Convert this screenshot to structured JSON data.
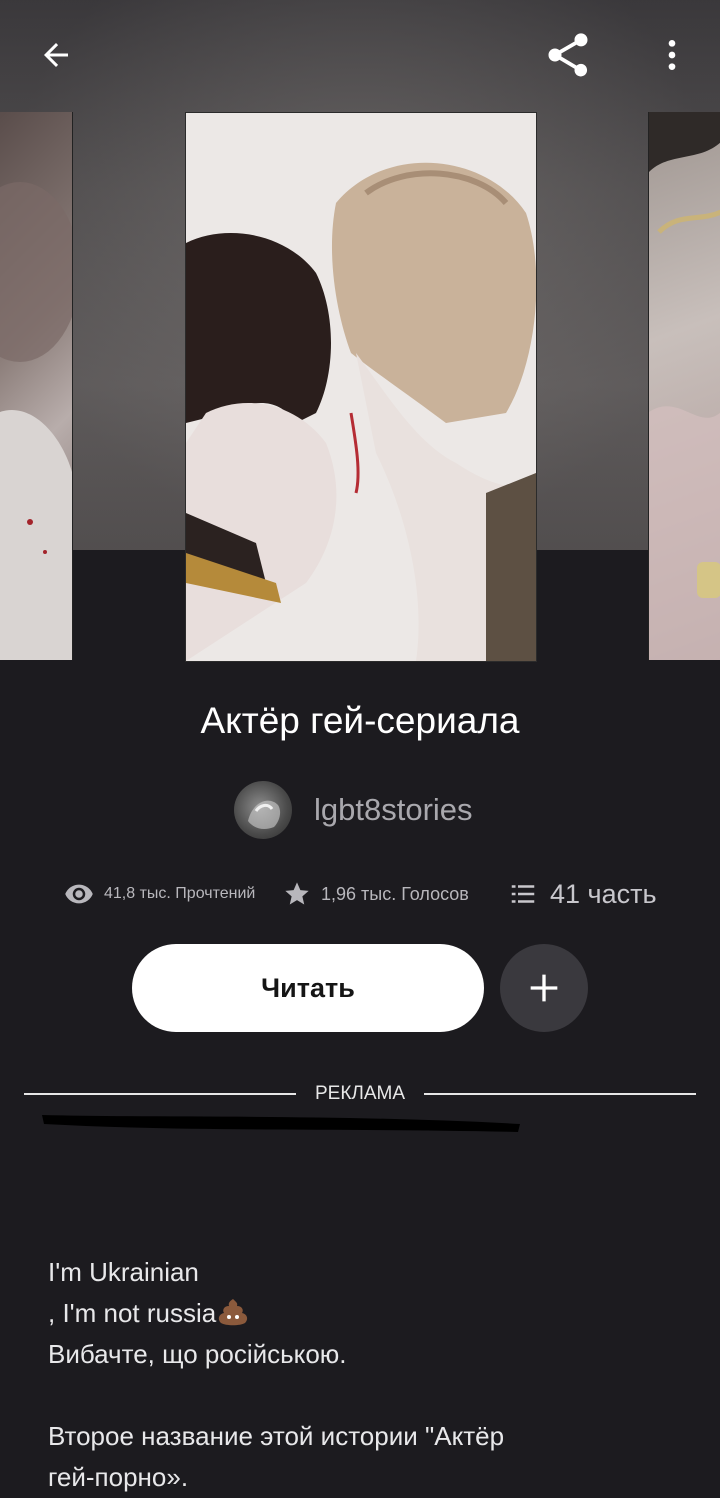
{
  "header": {
    "back_icon": "arrow-left-icon",
    "share_icon": "share-icon",
    "more_icon": "more-vertical-icon"
  },
  "story": {
    "title": "Актёр гей-сериала",
    "author": "lgbt8stories"
  },
  "stats": {
    "reads": "41,8 тыс. Прочтений",
    "votes": "1,96 тыс. Голосов",
    "parts": "41 часть"
  },
  "actions": {
    "read_label": "Читать",
    "add_icon": "plus-icon"
  },
  "ad": {
    "label": "РЕКЛАМА"
  },
  "description": {
    "line1_a": "I'm Ukrainian",
    "line1_b": ", I'm not russia",
    "line2": "Вибачте, що російською.",
    "line3": "Второе название этой истории \"Актёр",
    "line4": "гей-порно»."
  },
  "colors": {
    "background": "#1c1b1f",
    "button_bg": "#ffffff",
    "add_button_bg": "#3a393e",
    "muted_text": "#b8b7bc"
  }
}
